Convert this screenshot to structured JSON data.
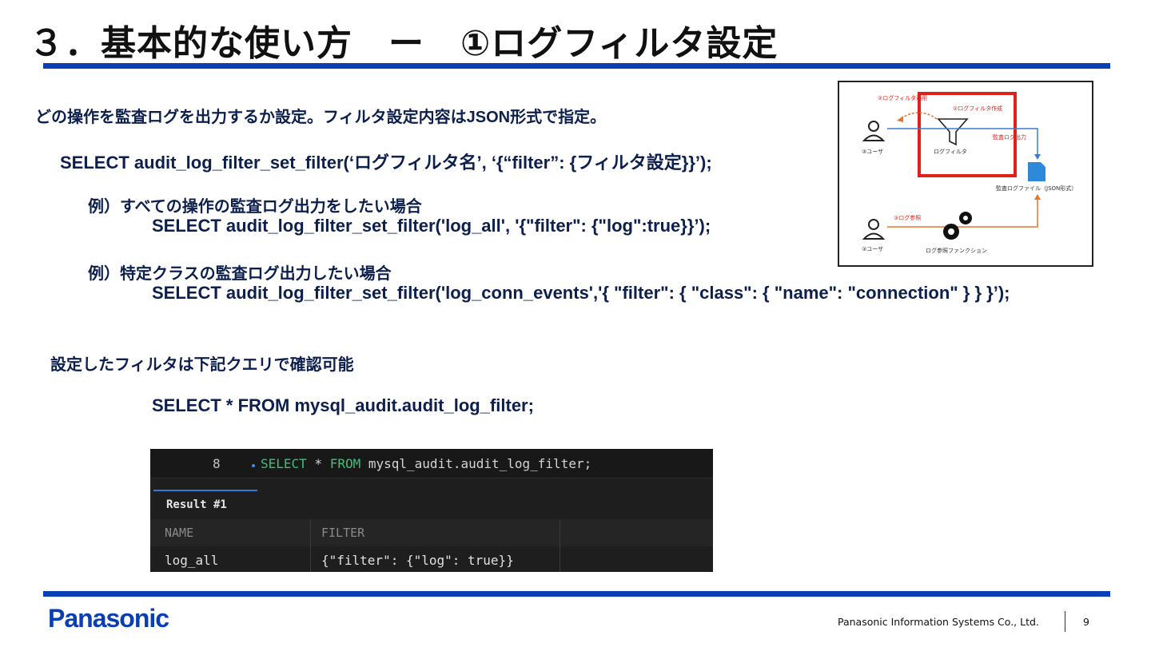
{
  "title": "３．基本的な使い方　ー　①ログフィルタ設定",
  "body": {
    "intro": "どの操作を監査ログを出力するか設定。フィルタ設定内容はJSON形式で指定。",
    "syntax": "SELECT audit_log_filter_set_filter(‘ログフィルタ名’, ‘{“filter”: {フィルタ設定}}’);",
    "example1_label": "例）すべての操作の監査ログ出力をしたい場合",
    "example1_sql": "SELECT audit_log_filter_set_filter('log_all', '{\"filter\": {\"log\":true}}’);",
    "example2_label": "例）特定クラスの監査ログ出力したい場合",
    "example2_sql": "SELECT audit_log_filter_set_filter('log_conn_events','{ \"filter\": { \"class\": { \"name\": \"connection\" } } }’);",
    "confirm_label": "設定したフィルタは下記クエリで確認可能",
    "confirm_sql": "SELECT * FROM mysql_audit.audit_log_filter;"
  },
  "diagram": {
    "step1": "①ログフィルタ作成",
    "step2": "②ログフィルタ適用",
    "step3": "③ログ参照",
    "user1": "③ユーザ",
    "user2": "③ユーザ",
    "filter": "ログフィルタ",
    "output": "監査ログ出力",
    "file": "監査ログファイル（JSON形式）",
    "function": "ログ参照ファンクション",
    "colors": {
      "red": "#e0201a",
      "orange": "#e8742a",
      "blue": "#3a7bd5"
    }
  },
  "code_panel": {
    "line_number": "8",
    "kw_select": "SELECT",
    "star": " * ",
    "kw_from": "FROM",
    "rest": " mysql_audit.audit_log_filter;",
    "result_tab": "Result #1",
    "columns": [
      "NAME",
      "FILTER"
    ],
    "row": [
      "log_all",
      "{\"filter\": {\"log\": true}}"
    ]
  },
  "footer": {
    "logo": "Panasonic",
    "company": "Panasonic Information Systems Co., Ltd.",
    "page": "9"
  }
}
